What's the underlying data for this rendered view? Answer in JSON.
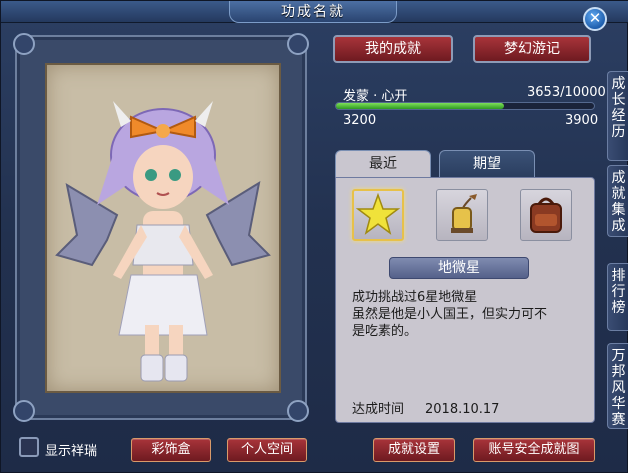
{
  "window": {
    "title": "功成名就"
  },
  "top_buttons": {
    "my_achievements": "我的成就",
    "dream_travels": "梦幻游记"
  },
  "progress": {
    "name": "发蒙 · 心开",
    "current_total": "3653/10000",
    "range_min": "3200",
    "range_max": "3900",
    "fill_fraction": 0.65
  },
  "tabs": [
    {
      "label": "最近"
    },
    {
      "label": "期望"
    }
  ],
  "slots": [
    {
      "icon": "star-icon"
    },
    {
      "icon": "lantern-icon"
    },
    {
      "icon": "backpack-icon"
    }
  ],
  "achievement": {
    "name": "地微星",
    "desc_lines": [
      "成功挑战过6星地微星",
      "虽然是他是小人国王，但实力可不",
      "是吃素的。"
    ],
    "achieved_label": "达成时间",
    "achieved_date": "2018.10.17"
  },
  "side_tabs": [
    {
      "label": "成长经历"
    },
    {
      "label": "成就集成"
    },
    {
      "label": "排行榜"
    },
    {
      "label": "万邦风华赛"
    }
  ],
  "bottom": {
    "show_auspicious": "显示祥瑞",
    "decoration_box": "彩饰盒",
    "personal_space": "个人空间",
    "achievement_settings": "成就设置",
    "account_security": "账号安全成就图"
  }
}
